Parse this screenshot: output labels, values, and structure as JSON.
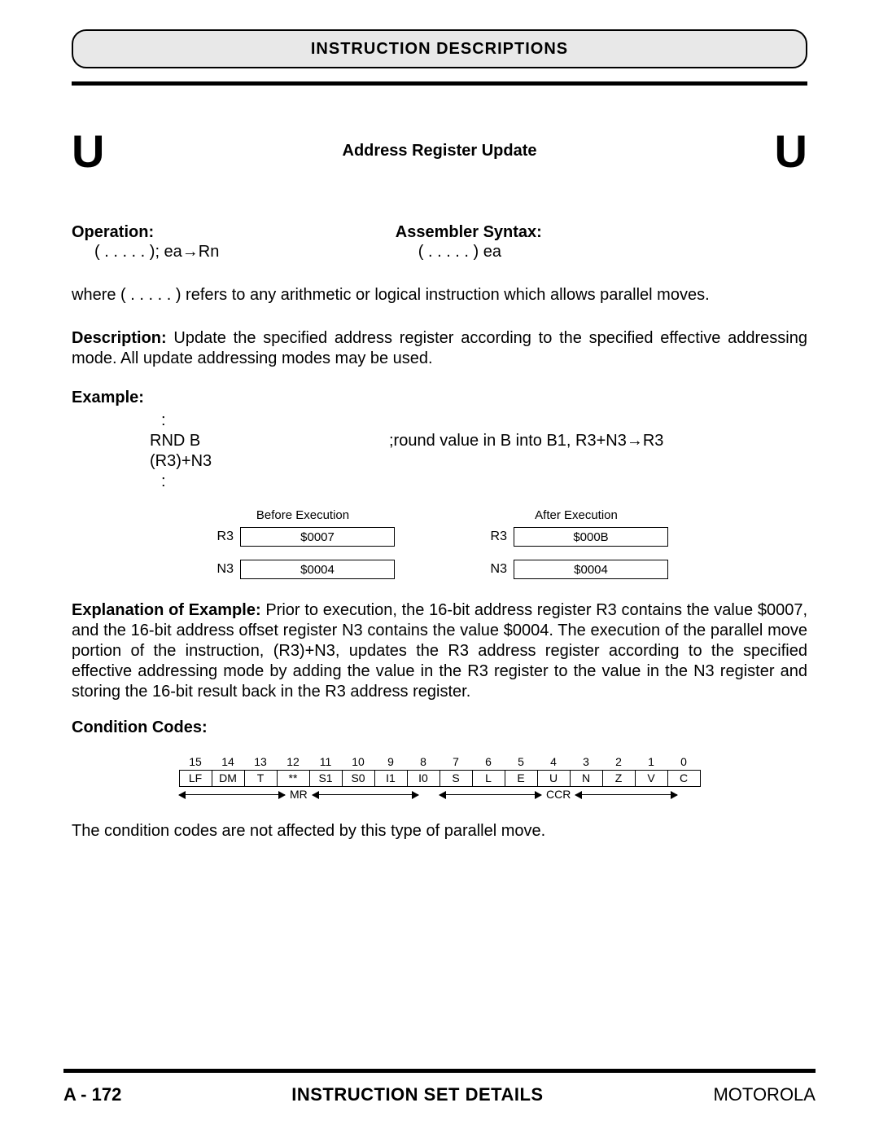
{
  "header": {
    "title": "INSTRUCTION DESCRIPTIONS"
  },
  "mnemonic_left": "U",
  "mnemonic_right": "U",
  "subtitle": "Address Register Update",
  "operation": {
    "label": "Operation:",
    "text": "( . . . . . ); ea→Rn"
  },
  "assembler": {
    "label": "Assembler Syntax:",
    "text": "( . . . . . ) ea"
  },
  "where_text": "where ( . . . . . ) refers to any arithmetic or logical instruction which allows parallel moves.",
  "description_label": "Description:",
  "description_text": " Update the specified address register according to the specified effective addressing mode. All update addressing modes may be used.",
  "example": {
    "label": "Example:",
    "dots_top": ":",
    "code": "RND B  (R3)+N3",
    "comment": ";round value in B into B1, R3+N3→R3",
    "dots_bottom": ":"
  },
  "registers": {
    "before_label": "Before Execution",
    "after_label": "After Execution",
    "rows": [
      {
        "name": "R3",
        "before": "$0007",
        "after": "$000B"
      },
      {
        "name": "N3",
        "before": "$0004",
        "after": "$0004"
      }
    ]
  },
  "explanation_label": "Explanation of Example:",
  "explanation_text": " Prior to execution, the 16-bit address register R3 contains the value $0007, and the 16-bit address offset register N3 contains the value $0004. The execution of the parallel move portion of the instruction, (R3)+N3, updates the R3 address register according to the specified effective addressing mode by adding the value in the R3 register to the value in the N3 register and storing the 16-bit result back in the R3 address register.",
  "cc": {
    "label": "Condition Codes:",
    "bits": [
      "15",
      "14",
      "13",
      "12",
      "11",
      "10",
      "9",
      "8",
      "7",
      "6",
      "5",
      "4",
      "3",
      "2",
      "1",
      "0"
    ],
    "names": [
      "LF",
      "DM",
      "T",
      "**",
      "S1",
      "S0",
      "I1",
      "I0",
      "S",
      "L",
      "E",
      "U",
      "N",
      "Z",
      "V",
      "C"
    ],
    "mr_label": "MR",
    "ccr_label": "CCR",
    "note": "The condition codes are not affected by this type of parallel move."
  },
  "footer": {
    "left": "A - 172",
    "center": "INSTRUCTION SET DETAILS",
    "right": "MOTOROLA"
  }
}
